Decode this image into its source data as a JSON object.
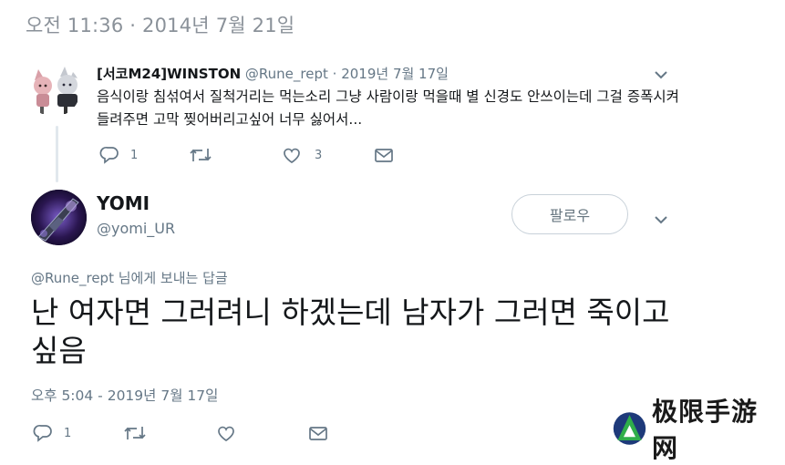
{
  "header": {
    "timestamp": "오전 11:36 · 2014년 7월 21일"
  },
  "parent_tweet": {
    "display_name": "[서코M24]WINSTON",
    "handle": "@Rune_rept",
    "date": "· 2019년 7월 17일",
    "text": "음식이랑 침섞여서 질척거리는 먹는소리 그냥 사람이랑 먹을때 별 신경도 안쓰이는데 그걸 증폭시켜 들려주면 고막 찢어버리고싶어 너무 싫어서...",
    "reply_count": "1",
    "retweet_count": "",
    "like_count": "3",
    "icons": [
      "reply-icon",
      "retweet-icon",
      "like-icon",
      "message-icon",
      "chevron-down-icon"
    ]
  },
  "main_tweet": {
    "display_name": "YOMI",
    "handle": "@yomi_UR",
    "follow_label": "팔로우",
    "replying_to_handle": "@Rune_rept",
    "replying_to_suffix": " 님에게 보내는 답글",
    "text": "난 여자면 그러려니 하겠는데 남자가 그러면 죽이고싶음",
    "time": "오후 5:04 - 2019년 7월 17일",
    "reply_count": "1",
    "icons": [
      "reply-icon",
      "retweet-icon",
      "like-icon",
      "message-icon",
      "chevron-down-icon"
    ]
  },
  "watermark": {
    "text": "极限手游网"
  },
  "colors": {
    "secondary_text": "#657786",
    "primary_text": "#14171a",
    "border": "#c8d1d9",
    "thread_line": "#e1e8ed"
  }
}
